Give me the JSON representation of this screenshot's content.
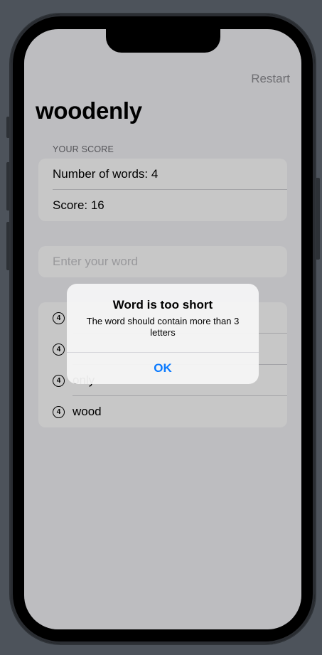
{
  "nav": {
    "restart_label": "Restart"
  },
  "title": "woodenly",
  "score_section": {
    "header": "YOUR SCORE",
    "word_count_text": "Number of words: 4",
    "score_text": "Score: 16"
  },
  "input": {
    "placeholder": "Enter your word",
    "value": ""
  },
  "words": [
    {
      "count": "4",
      "word": ""
    },
    {
      "count": "4",
      "word": ""
    },
    {
      "count": "4",
      "word": "only"
    },
    {
      "count": "4",
      "word": "wood"
    }
  ],
  "alert": {
    "title": "Word is too short",
    "message": "The word should contain more than 3 letters",
    "button_label": "OK"
  },
  "colors": {
    "accent": "#0a7aff",
    "background": "#f2f2f7",
    "device_backdrop": "#4d535b"
  }
}
